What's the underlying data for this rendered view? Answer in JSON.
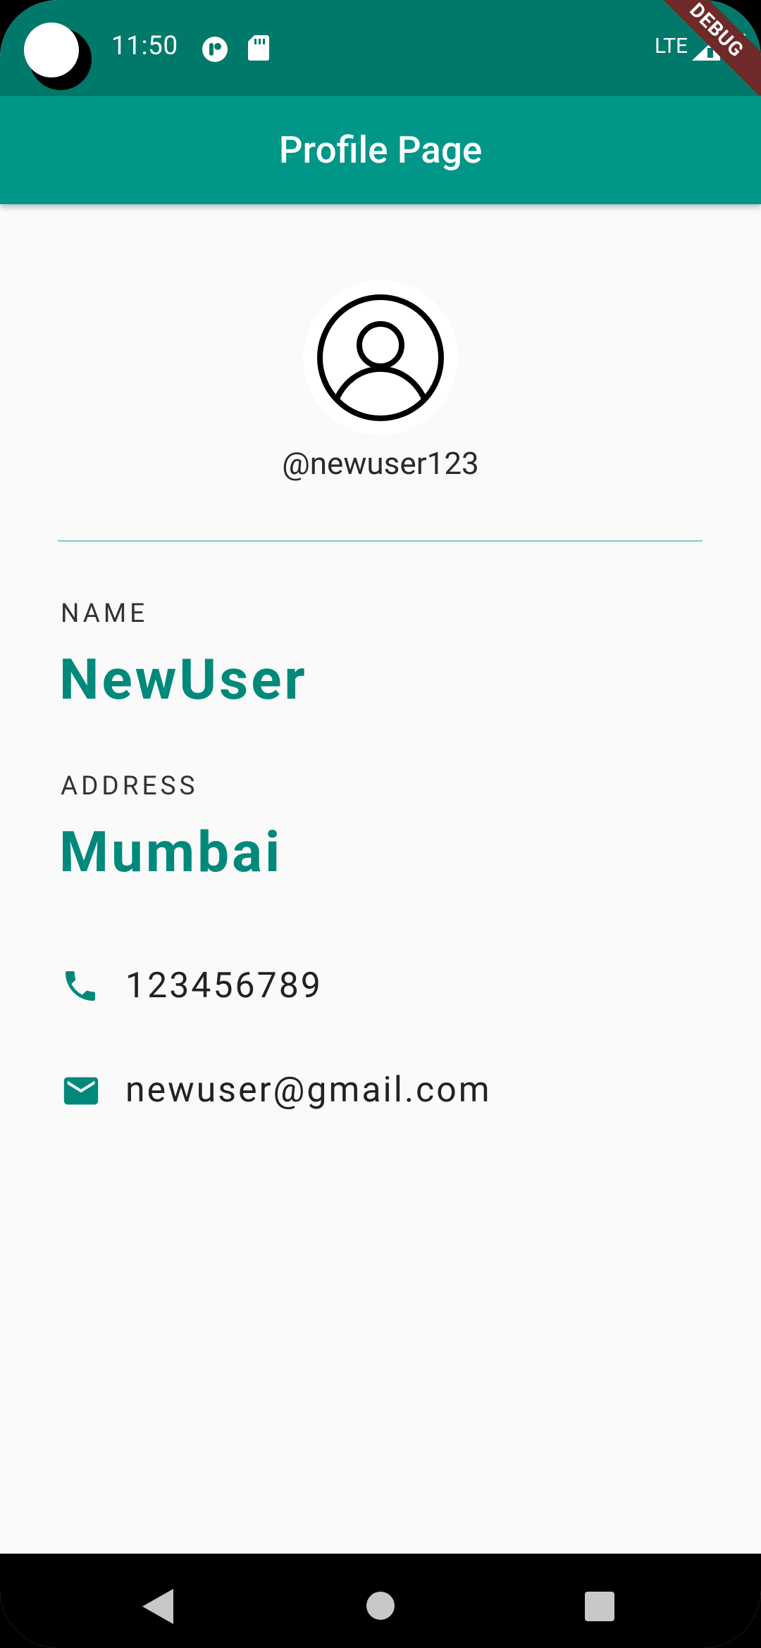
{
  "status_bar": {
    "time": "11:50",
    "network": "LTE",
    "debug_banner": "DEBUG",
    "icons": [
      "camera-cutout",
      "fitbit-icon",
      "sd-card-icon",
      "signal-icon",
      "battery-icon"
    ]
  },
  "app_bar": {
    "title": "Profile Page"
  },
  "profile": {
    "avatar_icon": "account-circle-icon",
    "username": "@newuser123"
  },
  "fields": {
    "name_label": "NAME",
    "name_value": "NewUser",
    "address_label": "ADDRESS",
    "address_value": "Mumbai"
  },
  "contact": {
    "phone_icon": "phone-icon",
    "phone": "123456789",
    "email_icon": "email-icon",
    "email": "newuser@gmail.com"
  },
  "nav_bar": {
    "buttons": [
      "back-icon",
      "home-icon",
      "recents-icon"
    ]
  },
  "colors": {
    "status_bar": "#00796b",
    "app_bar": "#009688",
    "accent": "#00897b",
    "divider": "#80cbc4",
    "background": "#fafafa"
  }
}
